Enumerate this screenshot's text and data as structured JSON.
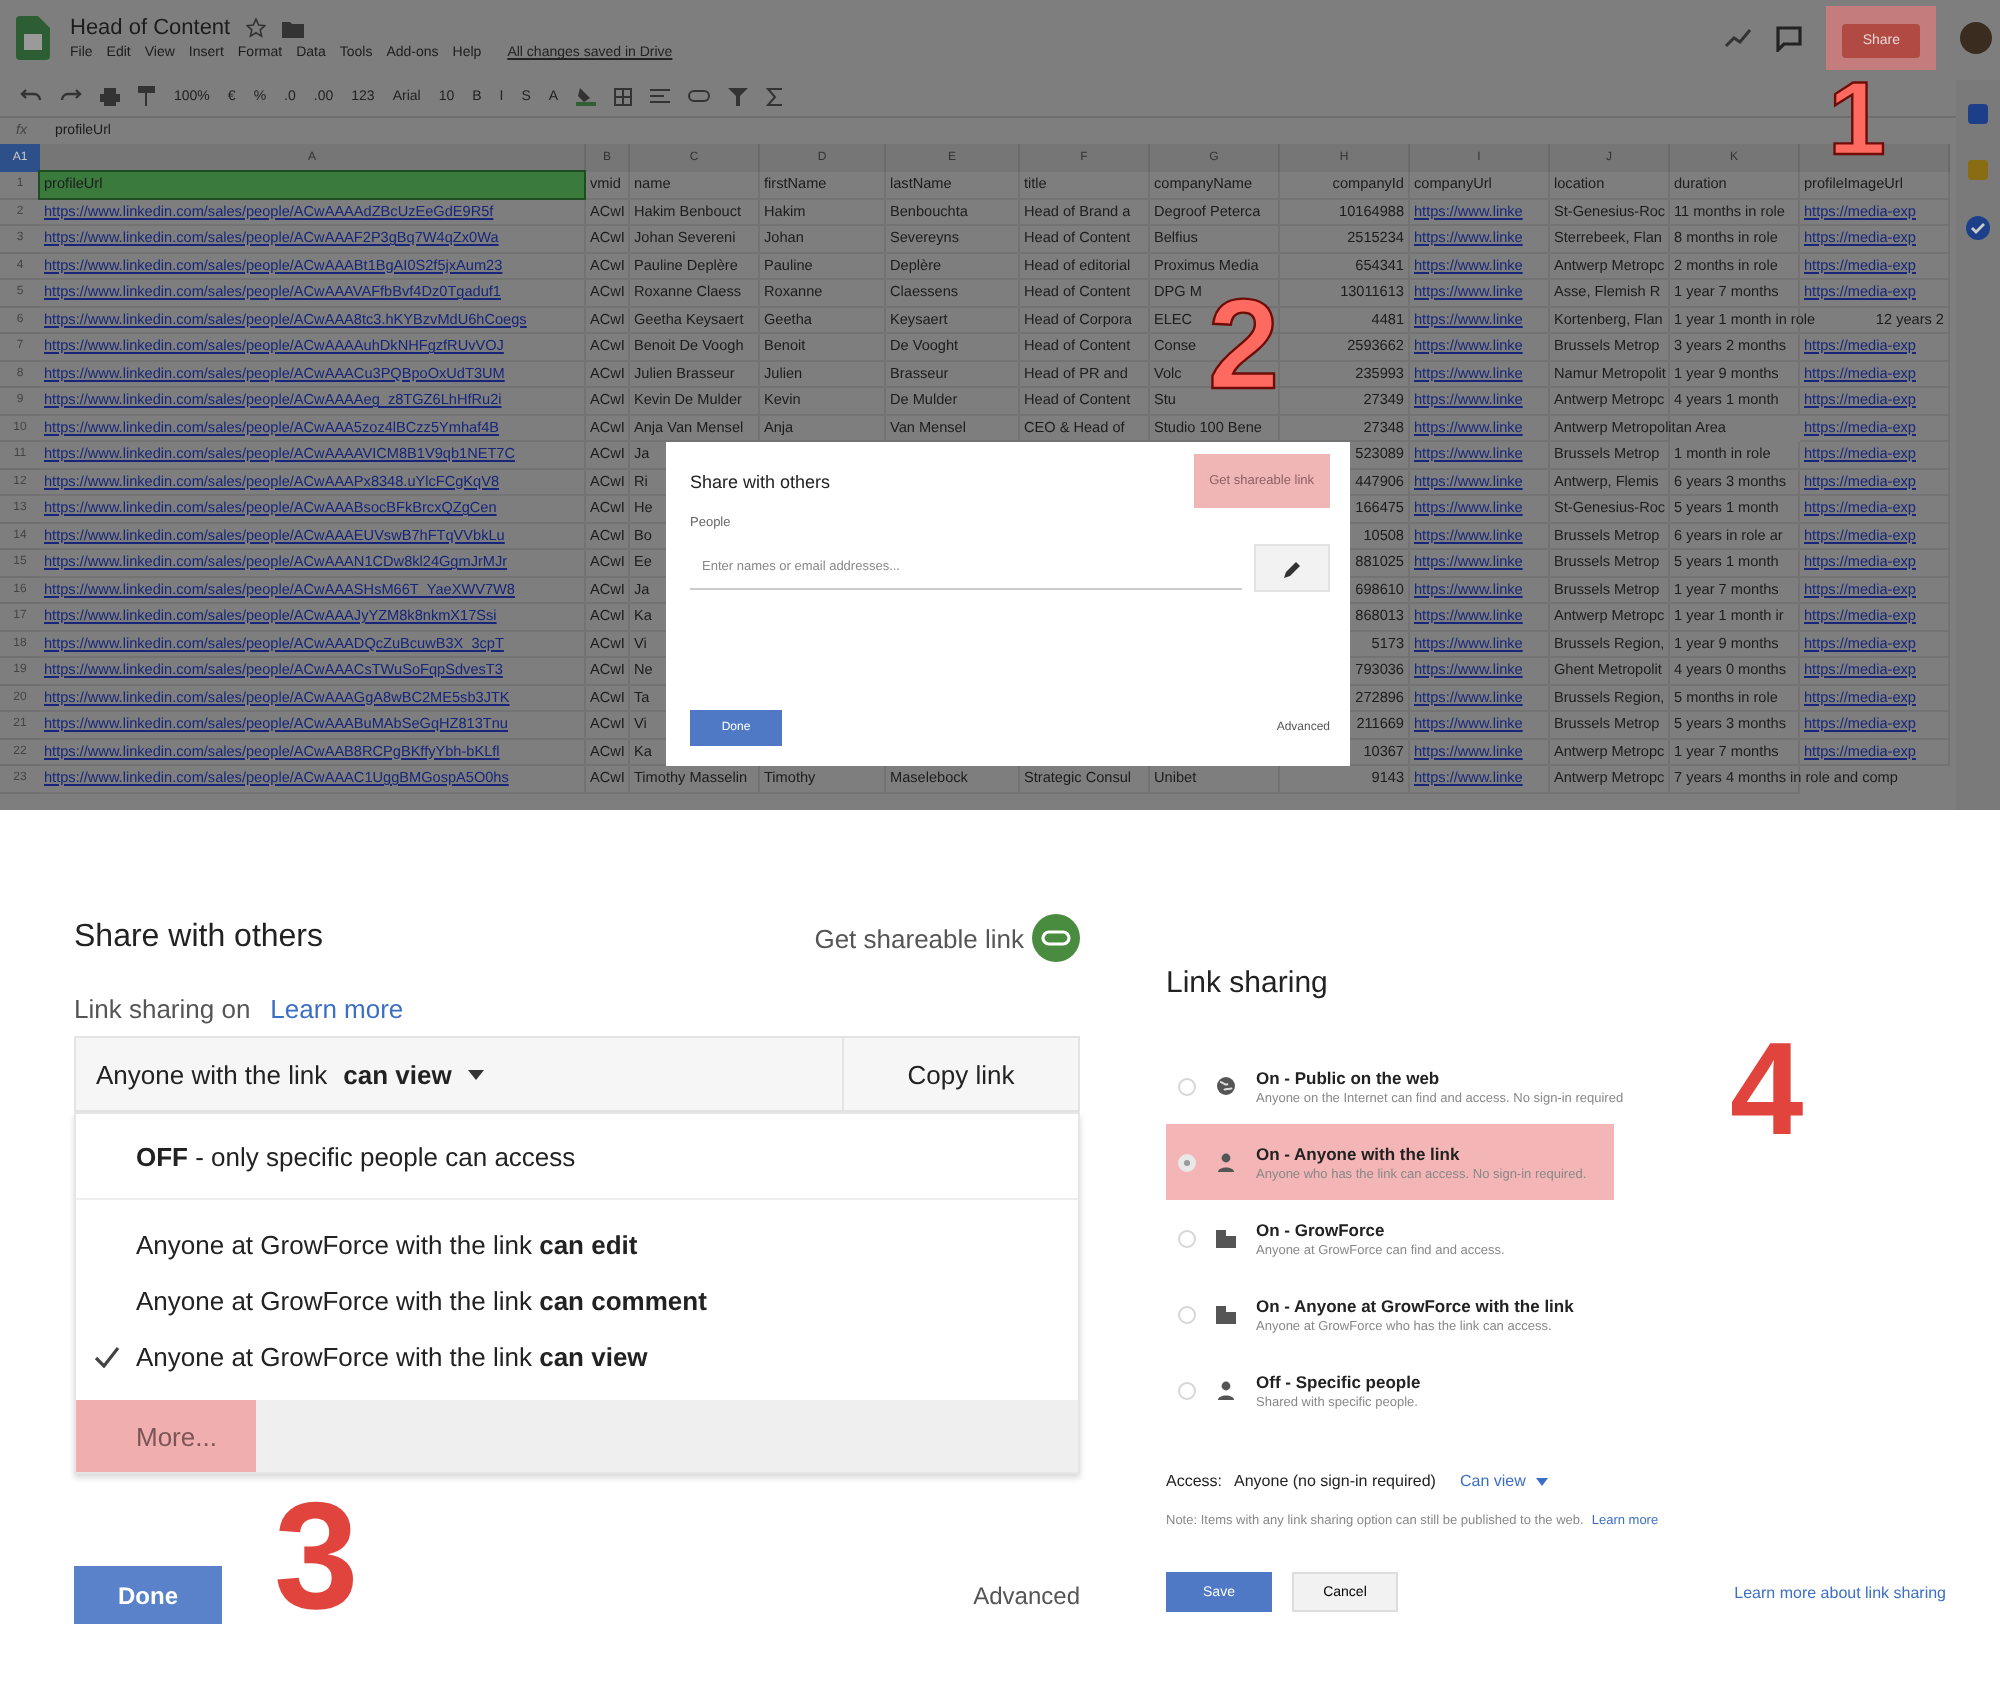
{
  "spreadsheet": {
    "title": "Head of Content",
    "menus": [
      "File",
      "Edit",
      "View",
      "Insert",
      "Format",
      "Data",
      "Tools",
      "Add-ons",
      "Help"
    ],
    "save_status": "All changes saved in Drive",
    "share_button": {
      "label": "Share",
      "highlighted": true
    },
    "toolbar": [
      "100%",
      "€",
      "%",
      ".0",
      ".00",
      "123",
      "Arial",
      "10",
      "B",
      "I",
      "S",
      "A"
    ],
    "formula_bar": {
      "fx": "fx",
      "value": "profileUrl"
    },
    "cell_ref": "A1",
    "columns": [
      {
        "letter": "A",
        "kind": "link"
      },
      {
        "letter": "B",
        "kind": "text"
      },
      {
        "letter": "C",
        "kind": "text"
      },
      {
        "letter": "D",
        "kind": "text"
      },
      {
        "letter": "E",
        "kind": "text"
      },
      {
        "letter": "F",
        "kind": "text"
      },
      {
        "letter": "G",
        "kind": "text"
      },
      {
        "letter": "H",
        "kind": "number"
      },
      {
        "letter": "I",
        "kind": "link"
      },
      {
        "letter": "J",
        "kind": "text"
      },
      {
        "letter": "K",
        "kind": "text"
      },
      {
        "kind": "link"
      }
    ],
    "rows": [
      {
        "number": "1",
        "kind": "header",
        "selected": true,
        "cells": [
          "profileUrl",
          "vmid",
          "name",
          "firstName",
          "lastName",
          "title",
          "companyName",
          "companyId",
          "companyUrl",
          "location",
          "duration",
          "profileImageUrl"
        ]
      },
      {
        "number": "2",
        "kind": "data",
        "selected": false,
        "cells": [
          "https://www.linkedin.com/sales/people/ACwAAAAdZBcUzEeGdE9R5f",
          "ACwI",
          "Hakim Benbouct",
          "Hakim",
          "Benbouchta",
          "Head of Brand a",
          "Degroof Peterca",
          "10164988",
          "https://www.linke",
          "St-Genesius-Roc",
          "11 months in role",
          "https://media-exp"
        ]
      },
      {
        "number": "3",
        "kind": "data",
        "selected": false,
        "cells": [
          "https://www.linkedin.com/sales/people/ACwAAAF2P3gBq7W4qZx0Wa",
          "ACwI",
          "Johan Severeni",
          "Johan",
          "Severeyns",
          "Head of Content",
          "Belfius",
          "2515234",
          "https://www.linke",
          "Sterrebeek, Flan",
          "8 months in role",
          "https://media-exp"
        ]
      },
      {
        "number": "4",
        "kind": "data",
        "selected": false,
        "cells": [
          "https://www.linkedin.com/sales/people/ACwAAABt1BgAI0S2f5jxAum23",
          "ACwI",
          "Pauline Deplère",
          "Pauline",
          "Deplère",
          "Head of editorial",
          "Proximus Media",
          "654341",
          "https://www.linke",
          "Antwerp Metropc",
          "2 months in role",
          "https://media-exp"
        ]
      },
      {
        "number": "5",
        "kind": "data",
        "selected": false,
        "cells": [
          "https://www.linkedin.com/sales/people/ACwAAAVAFfbBvf4Dz0Tgaduf1",
          "ACwI",
          "Roxanne Claess",
          "Roxanne",
          "Claessens",
          "Head of Content",
          "DPG M",
          "13011613",
          "https://www.linke",
          "Asse, Flemish R",
          "1 year 7 months",
          "https://media-exp"
        ]
      },
      {
        "number": "6",
        "kind": "data",
        "selected": false,
        "cells": [
          "https://www.linkedin.com/sales/people/ACwAAA8tc3.hKYBzvMdU6hCoegs",
          "ACwI",
          "Geetha Keysaert",
          "Geetha",
          "Keysaert",
          "Head of Corpora",
          "ELEC",
          "4481",
          "https://www.linke",
          "Kortenberg, Flan",
          "1 year 1 month in role",
          {
            "text": "12 years 2",
            "kind": "trailing"
          }
        ]
      },
      {
        "number": "7",
        "kind": "data",
        "selected": false,
        "cells": [
          "https://www.linkedin.com/sales/people/ACwAAAAuhDkNHFgzfRUvVOJ",
          "ACwI",
          "Benoit De Voogh",
          "Benoit",
          "De Vooght",
          "Head of Content",
          "Conse",
          "2593662",
          "https://www.linke",
          "Brussels Metrop",
          "3 years 2 months",
          "https://media-exp"
        ]
      },
      {
        "number": "8",
        "kind": "data",
        "selected": false,
        "cells": [
          "https://www.linkedin.com/sales/people/ACwAAACu3PQBpoOxUdT3UM",
          "ACwI",
          "Julien Brasseur",
          "Julien",
          "Brasseur",
          "Head of PR and",
          "Volc",
          "235993",
          "https://www.linke",
          "Namur Metropolit",
          "1 year 9 months",
          "https://media-exp"
        ]
      },
      {
        "number": "9",
        "kind": "data",
        "selected": false,
        "cells": [
          "https://www.linkedin.com/sales/people/ACwAAAAeg_z8TGZ6LhHfRu2i",
          "ACwI",
          "Kevin De Mulder",
          "Kevin",
          "De Mulder",
          "Head of Content",
          "Stu",
          "27349",
          "https://www.linke",
          "Antwerp Metropc",
          "4 years 1 month",
          "https://media-exp"
        ]
      },
      {
        "number": "10",
        "kind": "data",
        "selected": false,
        "cells": [
          "https://www.linkedin.com/sales/people/ACwAAA5zoz4lBCzz5Ymhaf4B",
          "ACwI",
          "Anja Van Mensel",
          "Anja",
          "Van Mensel",
          "CEO & Head of",
          "Studio 100 Bene",
          "27348",
          "https://www.linke",
          "Antwerp Metropolitan Area",
          null,
          "https://media-exp"
        ]
      },
      {
        "number": "11",
        "kind": "data",
        "selected": false,
        "cells": [
          "https://www.linkedin.com/sales/people/ACwAAAAVICM8B1V9qb1NET7C",
          "ACwI",
          "Ja",
          null,
          null,
          null,
          null,
          "523089",
          "https://www.linke",
          "Brussels Metrop",
          "1 month in role",
          "https://media-exp"
        ]
      },
      {
        "number": "12",
        "kind": "data",
        "selected": false,
        "cells": [
          "https://www.linkedin.com/sales/people/ACwAAAPx8348.uYlcFCgKqV8",
          "ACwI",
          "Ri",
          null,
          null,
          null,
          null,
          "447906",
          "https://www.linke",
          "Antwerp, Flemis",
          "6 years 3 months",
          "https://media-exp"
        ]
      },
      {
        "number": "13",
        "kind": "data",
        "selected": false,
        "cells": [
          "https://www.linkedin.com/sales/people/ACwAAABsocBFkBrcxQZgCen",
          "ACwI",
          "He",
          null,
          null,
          null,
          null,
          "166475",
          "https://www.linke",
          "St-Genesius-Roc",
          "5 years 1 month",
          "https://media-exp"
        ]
      },
      {
        "number": "14",
        "kind": "data",
        "selected": false,
        "cells": [
          "https://www.linkedin.com/sales/people/ACwAAAEUVswB7hFTqVVbkLu",
          "ACwI",
          "Bo",
          null,
          null,
          null,
          null,
          "10508",
          "https://www.linke",
          "Brussels Metrop",
          "6 years in role ar",
          "https://media-exp"
        ]
      },
      {
        "number": "15",
        "kind": "data",
        "selected": false,
        "cells": [
          "https://www.linkedin.com/sales/people/ACwAAAN1CDw8kl24GgmJrMJr",
          "ACwI",
          "Ee",
          null,
          null,
          null,
          null,
          "881025",
          "https://www.linke",
          "Brussels Metrop",
          "5 years 1 month",
          "https://media-exp"
        ]
      },
      {
        "number": "16",
        "kind": "data",
        "selected": false,
        "cells": [
          "https://www.linkedin.com/sales/people/ACwAAASHsM66T_YaeXWV7W8",
          "ACwI",
          "Ja",
          null,
          null,
          null,
          null,
          "698610",
          "https://www.linke",
          "Brussels Metrop",
          "1 year 7 months",
          "https://media-exp"
        ]
      },
      {
        "number": "17",
        "kind": "data",
        "selected": false,
        "cells": [
          "https://www.linkedin.com/sales/people/ACwAAAJyYZM8k8nkmX17Ssi",
          "ACwI",
          "Ka",
          null,
          null,
          null,
          null,
          "868013",
          "https://www.linke",
          "Antwerp Metropc",
          "1 year 1 month ir",
          "https://media-exp"
        ]
      },
      {
        "number": "18",
        "kind": "data",
        "selected": false,
        "cells": [
          "https://www.linkedin.com/sales/people/ACwAAADQcZuBcuwB3X_3cpT",
          "ACwI",
          "Vi",
          null,
          null,
          null,
          null,
          "5173",
          "https://www.linke",
          "Brussels Region,",
          "1 year 9 months",
          "https://media-exp"
        ]
      },
      {
        "number": "19",
        "kind": "data",
        "selected": false,
        "cells": [
          "https://www.linkedin.com/sales/people/ACwAAACsTWuSoFqpSdvesT3",
          "ACwI",
          "Ne",
          null,
          null,
          null,
          null,
          "793036",
          "https://www.linke",
          "Ghent Metropolit",
          "4 years 0 months",
          "https://media-exp"
        ]
      },
      {
        "number": "20",
        "kind": "data",
        "selected": false,
        "cells": [
          "https://www.linkedin.com/sales/people/ACwAAAGgA8wBC2ME5sb3JTK",
          "ACwI",
          "Ta",
          null,
          null,
          null,
          null,
          "272896",
          "https://www.linke",
          "Brussels Region,",
          "5 months in role",
          "https://media-exp"
        ]
      },
      {
        "number": "21",
        "kind": "data",
        "selected": false,
        "cells": [
          "https://www.linkedin.com/sales/people/ACwAAABuMAbSeGqHZ813Tnu",
          "ACwI",
          "Vi",
          null,
          null,
          null,
          null,
          "211669",
          "https://www.linke",
          "Brussels Metrop",
          "5 years 3 months",
          "https://media-exp"
        ]
      },
      {
        "number": "22",
        "kind": "data",
        "selected": false,
        "cells": [
          "https://www.linkedin.com/sales/people/ACwAAB8RCPgBKffyYbh-bKLfl",
          "ACwI",
          "Ka",
          null,
          null,
          null,
          null,
          "10367",
          "https://www.linke",
          "Antwerp Metropc",
          "1 year 7 months",
          "https://media-exp"
        ]
      },
      {
        "number": "23",
        "kind": "data",
        "selected": false,
        "cells": [
          "https://www.linkedin.com/sales/people/ACwAAAC1UggBMGospA5O0hs",
          "ACwI",
          "Timothy Masselin",
          "Timothy",
          "Maselebock",
          "Strategic Consul",
          "Unibet",
          "9143",
          "https://www.linke",
          "Antwerp Metropc",
          "7 years 4 months in role and comp",
          null
        ]
      }
    ],
    "share_dialog": {
      "title": "Share with others",
      "get_link": {
        "label": "Get shareable link",
        "highlighted": true
      },
      "people_label": "People",
      "placeholder": "Enter names or email addresses...",
      "done": "Done",
      "advanced": "Advanced"
    }
  },
  "sharing_dialog": {
    "title": "Share with others",
    "get_link": "Get shareable link",
    "status": "Link sharing on",
    "learn_more": "Learn more",
    "access_dropdown": "Anyone with the link **can view**",
    "copy_link": "Copy link",
    "menu": [
      {
        "kind": "off",
        "text": "**OFF** - only specific people can access",
        "checked": false,
        "highlighted": false
      },
      {
        "kind": "level",
        "text": "Anyone at GrowForce with the link **can edit**",
        "checked": false,
        "highlighted": false
      },
      {
        "kind": "level",
        "text": "Anyone at GrowForce with the link **can comment**",
        "checked": false,
        "highlighted": false
      },
      {
        "kind": "level",
        "text": "Anyone at GrowForce with the link **can view**",
        "checked": true,
        "highlighted": false
      },
      {
        "kind": "more",
        "text": "More...",
        "highlighted": true
      }
    ],
    "done": "Done",
    "advanced": "Advanced"
  },
  "link_sharing": {
    "title": "Link sharing",
    "options": [
      {
        "kind": "public",
        "title": "On - Public on the web",
        "description": "Anyone on the Internet can find and access. No sign-in required",
        "selected": false,
        "highlighted": false
      },
      {
        "kind": "link",
        "title": "On - Anyone with the link",
        "description": "Anyone who has the link can access. No sign-in required.",
        "selected": true,
        "highlighted": true
      },
      {
        "kind": "domain",
        "title": "On - GrowForce",
        "description": "Anyone at GrowForce can find and access.",
        "selected": false,
        "highlighted": false
      },
      {
        "kind": "domain",
        "title": "On - Anyone at GrowForce with the link",
        "description": "Anyone at GrowForce who has the link can access.",
        "selected": false,
        "highlighted": false
      },
      {
        "kind": "off",
        "title": "Off - Specific people",
        "description": "Shared with specific people.",
        "selected": false,
        "highlighted": false
      }
    ],
    "access_label": "Access:",
    "access_value": "Anyone (no sign-in required)",
    "access_level": "Can view",
    "note": "Note: Items with any link sharing option can still be published to the web.",
    "note_link": "Learn more",
    "save": "Save",
    "cancel": "Cancel",
    "help_link": "Learn more about link sharing"
  },
  "annotations": [
    {
      "label": "1"
    },
    {
      "label": "2"
    },
    {
      "label": "3"
    },
    {
      "label": "4"
    }
  ]
}
